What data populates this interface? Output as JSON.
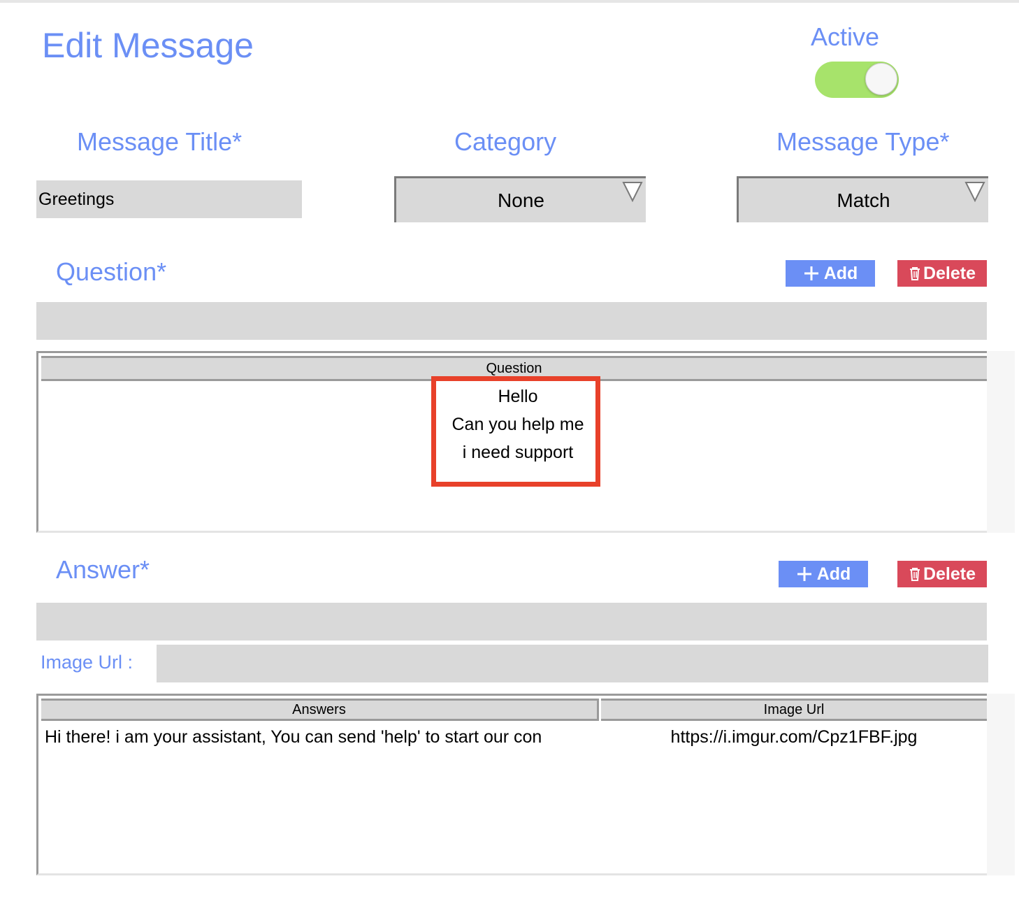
{
  "header": {
    "title": "Edit Message",
    "active_label": "Active",
    "active_on": true
  },
  "fields": {
    "message_title_label": "Message Title*",
    "message_title_value": "Greetings",
    "category_label": "Category",
    "category_value": "None",
    "message_type_label": "Message Type*",
    "message_type_value": "Match"
  },
  "question": {
    "label": "Question*",
    "add_label": "Add",
    "delete_label": "Delete",
    "input_value": "",
    "table": {
      "column": "Question",
      "rows": [
        "Hello",
        "Can you help me",
        "i need support"
      ]
    }
  },
  "answer": {
    "label": "Answer*",
    "add_label": "Add",
    "delete_label": "Delete",
    "input_value": "",
    "image_url_label": "Image Url :",
    "image_url_value": "",
    "table": {
      "columns": [
        "Answers",
        "Image Url"
      ],
      "rows": [
        {
          "answer": "Hi there! i am your assistant, You can send 'help' to start our con",
          "image_url": "https://i.imgur.com/Cpz1FBF.jpg"
        }
      ]
    }
  },
  "colors": {
    "accent": "#6b8ff5",
    "delete": "#d9495a",
    "toggle_on": "#a7e36b",
    "highlight": "#e8412a",
    "field_bg": "#d9d9d9"
  }
}
